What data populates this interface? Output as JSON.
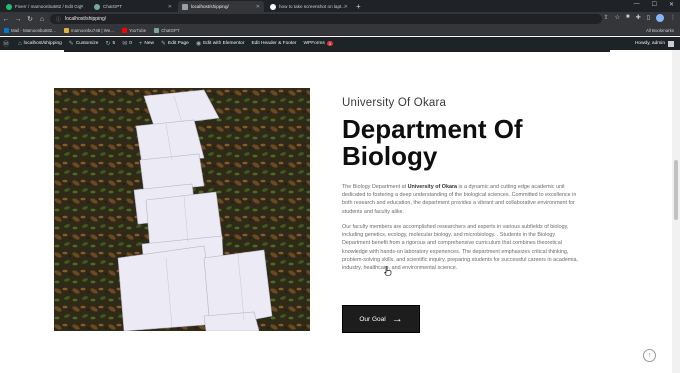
{
  "browser": {
    "tabs": [
      {
        "title": "Fiverr / mamoonbu582 / Edit Gig",
        "color": "#1dbf73",
        "active": false
      },
      {
        "title": "ChatGPT",
        "color": "#74aa9c",
        "active": false
      },
      {
        "title": "localhost/shipping/",
        "color": "#9aa0a6",
        "active": true
      },
      {
        "title": "how to take screenshot on lapt...",
        "color": "#9aa0a6",
        "active": false
      }
    ],
    "new_tab": "+",
    "url": "localhost/shipping/",
    "bookmarks": [
      {
        "label": "Mail - Mamoonbu582...",
        "color": "#0078d4"
      },
      {
        "label": "mamoonbu748 | We...",
        "color": "#e2b33a"
      },
      {
        "label": "YouTube",
        "color": "#ff0000"
      },
      {
        "label": "ChatGPT",
        "color": "#74aa9c"
      }
    ],
    "all_bookmarks": "All Bookmarks"
  },
  "adminbar": {
    "site": "localhost/shipping",
    "customize": "Customize",
    "updates": "5",
    "comments": "0",
    "new": "New",
    "edit_page": "Edit Page",
    "elementor": "Edit with Elementor",
    "header_footer": "Edit Header & Footer",
    "wpforms": "WPForms",
    "wpforms_badge": "1",
    "howdy": "Howdy, admin"
  },
  "content": {
    "eyebrow": "University Of Okara",
    "heading": "Department Of Biology",
    "p1_pre": "The Biology Department at ",
    "p1_bold": "University of Okara",
    "p1_post": " is a dynamic and cutting edge academic unit dedicated to fostering a deep understanding of the biological sciences. Committed to excellence in both research and education, the department provides a vibrant and collaborative environment for students and faculty alike.",
    "p2": "Our faculty members are accomplished researchers and experts in various subfields of biology, including genetics, ecology, molecular biology, and microbiology. . Students in the Biology Department benefit from a rigorous and comprehensive curriculum that combines theoretical knowledge with hands-on laboratory experiences. The department emphasizes critical thinking, problem-solving skills, and scientific inquiry, preparing students for successful careers in academia, industry, healthcare, and environmental science.",
    "cta_label": "Our Goal",
    "cta_icon": "arrow-right-icon"
  }
}
